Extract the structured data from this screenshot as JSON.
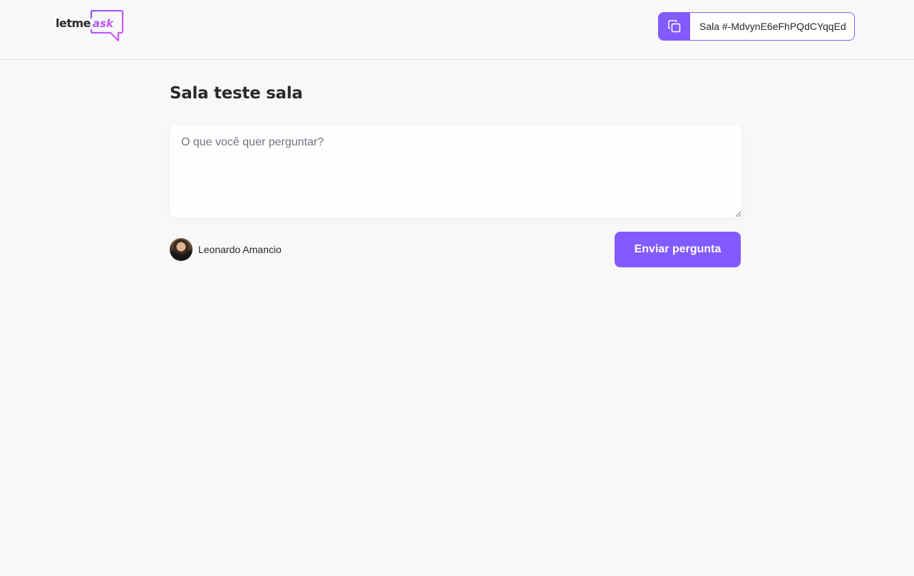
{
  "header": {
    "logo": {
      "text_prefix": "letme",
      "text_accent": "ask"
    },
    "room_code": {
      "label": "Sala #-MdvynE6eFhPQdCYqqEd",
      "icon": "copy-icon"
    }
  },
  "main": {
    "room_title": "Sala teste sala",
    "question_input": {
      "value": "",
      "placeholder": "O que você quer perguntar?"
    },
    "user": {
      "name": "Leonardo Amancio"
    },
    "submit_label": "Enviar pergunta"
  },
  "colors": {
    "accent": "#835afd",
    "logo_gradient_end": "#e559f9",
    "background": "#f8f8f8"
  }
}
